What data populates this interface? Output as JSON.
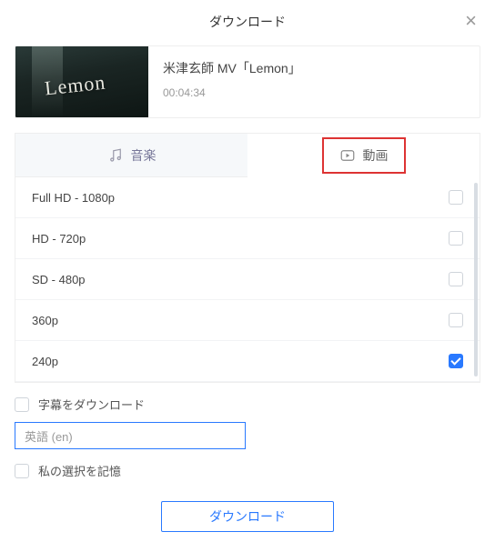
{
  "header": {
    "title": "ダウンロード"
  },
  "video": {
    "title": "米津玄師  MV「Lemon」",
    "duration": "00:04:34",
    "thumb_text": "Lemon"
  },
  "tabs": {
    "music": "音楽",
    "video": "動画"
  },
  "qualities": [
    {
      "label": "Full HD - 1080p",
      "checked": false
    },
    {
      "label": "HD - 720p",
      "checked": false
    },
    {
      "label": "SD - 480p",
      "checked": false
    },
    {
      "label": "360p",
      "checked": false
    },
    {
      "label": "240p",
      "checked": true
    }
  ],
  "options": {
    "subtitle_label": "字幕をダウンロード",
    "language_placeholder": "英語 (en)",
    "remember_label": "私の選択を記憶"
  },
  "footer": {
    "download": "ダウンロード"
  }
}
